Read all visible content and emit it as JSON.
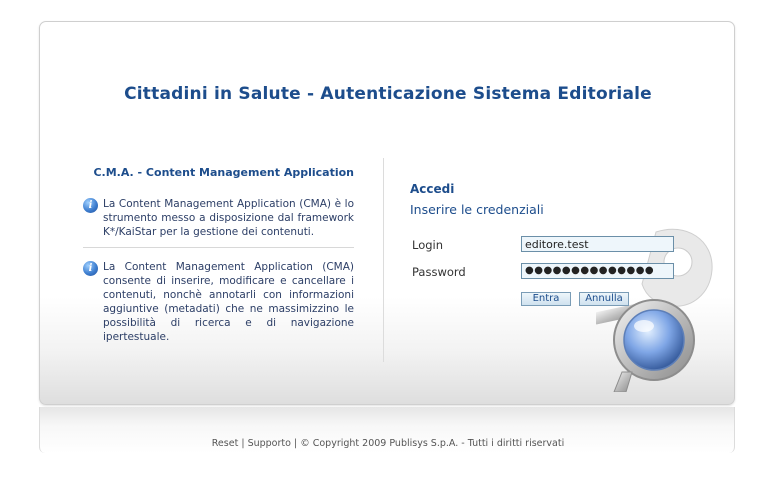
{
  "page": {
    "title": "Cittadini in Salute - Autenticazione Sistema Editoriale"
  },
  "info": {
    "heading": "C.M.A. - Content Management Application",
    "paragraph1": "La Content Management Application (CMA) è lo strumento messo a disposizione dal framework K*/KaiStar per la gestione dei contenuti.",
    "paragraph2": "La Content Management Application (CMA) consente di inserire, modificare e cancellare i contenuti, nonchè annotarli con informazioni aggiuntive (metadati) che ne massimizzino le possibilità di ricerca e di navigazione ipertestuale.",
    "icon": "info-icon"
  },
  "login": {
    "heading": "Accedi",
    "subheading": "Inserire le credenziali",
    "login_label": "Login",
    "login_value": "editore.test",
    "password_label": "Password",
    "password_value": "●●●●●●●●●●●●●●",
    "enter_label": "Entra",
    "cancel_label": "Annulla"
  },
  "footer": {
    "reset": "Reset",
    "support": "Supporto",
    "copyright": "© Copyright 2009 Publisys S.p.A. - Tutti i diritti riservati",
    "separator": "|"
  }
}
